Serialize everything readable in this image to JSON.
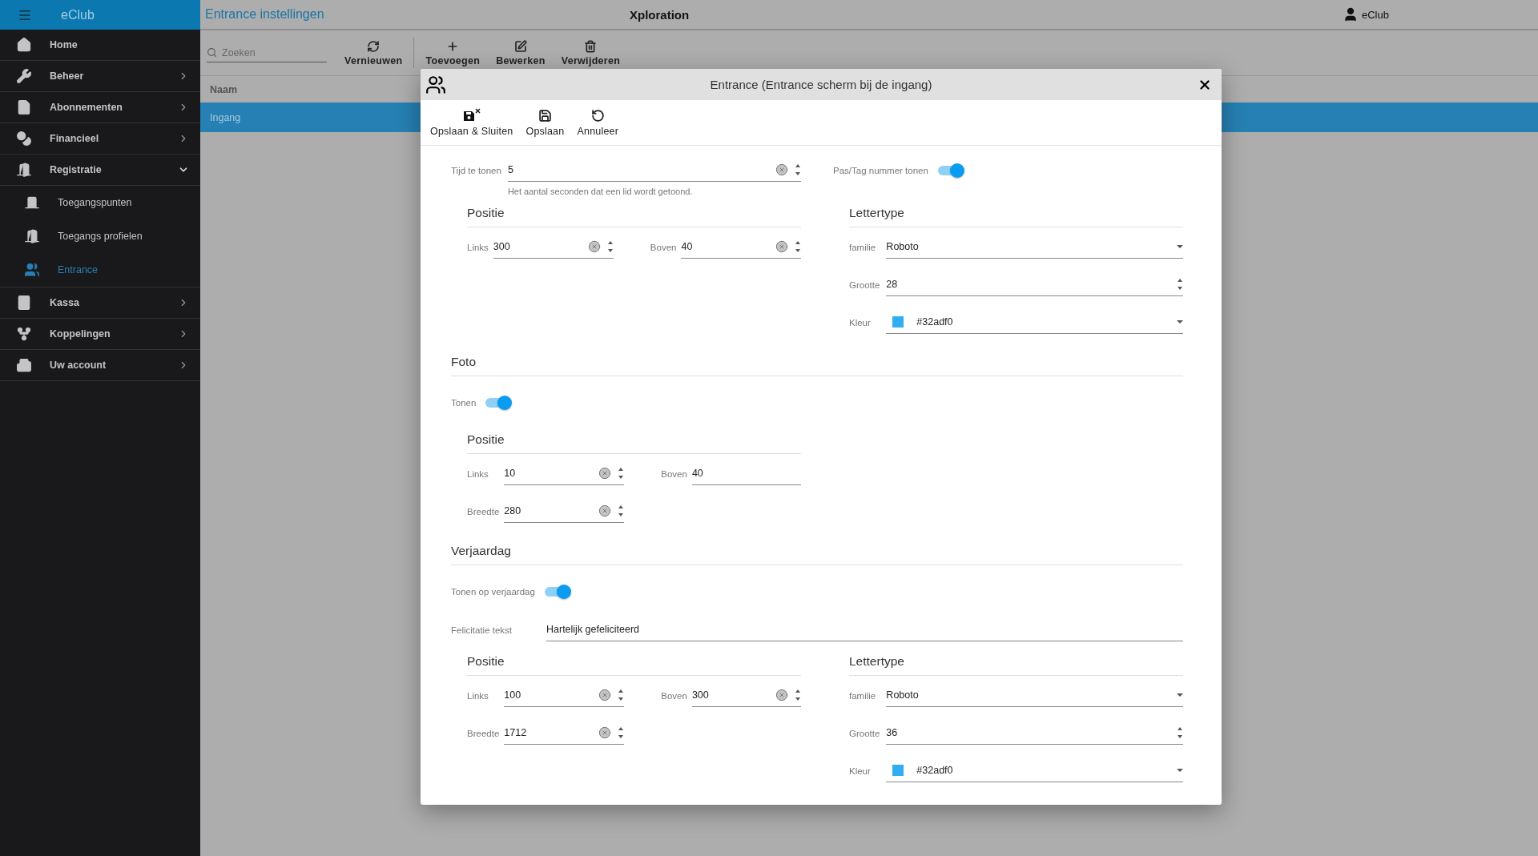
{
  "app": {
    "name": "eClub"
  },
  "sidebar": {
    "items": [
      {
        "label": "Home",
        "selected": false
      },
      {
        "label": "Beheer",
        "expanded": false,
        "selected": false
      },
      {
        "label": "Abonnementen",
        "expanded": false,
        "selected": false
      },
      {
        "label": "Financieel",
        "expanded": false,
        "selected": false
      },
      {
        "label": "Registratie",
        "expanded": true,
        "selected": false,
        "children": [
          {
            "label": "Toegangspunten",
            "selected": false
          },
          {
            "label": "Toegangs profielen",
            "selected": false
          },
          {
            "label": "Entrance",
            "selected": true
          }
        ]
      },
      {
        "label": "Kassa",
        "expanded": false,
        "selected": false
      },
      {
        "label": "Koppelingen",
        "expanded": false,
        "selected": false
      },
      {
        "label": "Uw account",
        "expanded": false,
        "selected": false
      }
    ]
  },
  "header": {
    "title": "Entrance instellingen",
    "center": "Xploration",
    "user": "eClub"
  },
  "toolbar": {
    "search": {
      "placeholder": "Zoeken"
    },
    "buttons": [
      {
        "label": "Vernieuwen"
      },
      {
        "label": "Toevoegen"
      },
      {
        "label": "Bewerken"
      },
      {
        "label": "Verwijderen"
      }
    ]
  },
  "table": {
    "columns": [
      "Naam"
    ],
    "rows": [
      {
        "cells": [
          "Ingang"
        ],
        "selected": true
      }
    ]
  },
  "dialog": {
    "title": "Entrance (Entrance scherm bij de ingang)",
    "toolbar": [
      {
        "label": "Opslaan & Sluiten"
      },
      {
        "label": "Opslaan"
      },
      {
        "label": "Annuleer"
      }
    ],
    "sections": [
      {
        "items": [
          {
            "kind": "pair",
            "field": {
              "kind": "number",
              "label": "Tijd te tonen",
              "value": "5",
              "hint": "Het aantal seconden dat een lid wordt getoond."
            },
            "toggle": {
              "label": "Pas/Tag nummer tonen",
              "on": true
            }
          },
          {
            "kind": "groups",
            "groups": [
              {
                "kind": "position",
                "title": "Positie",
                "fields": [
                  {
                    "kind": "number",
                    "label": "Links",
                    "value": "300"
                  },
                  {
                    "kind": "number",
                    "label": "Boven",
                    "value": "40"
                  }
                ]
              },
              {
                "kind": "font",
                "title": "Lettertype",
                "fields": [
                  {
                    "kind": "select",
                    "label": "familie",
                    "value": "Roboto"
                  },
                  {
                    "kind": "spin",
                    "label": "Grootte",
                    "value": "28"
                  },
                  {
                    "kind": "color",
                    "label": "Kleur",
                    "value": "#32adf0"
                  }
                ]
              }
            ]
          }
        ]
      },
      {
        "heading": "Foto",
        "items": [
          {
            "kind": "toggle",
            "label": "Tonen",
            "on": true
          },
          {
            "kind": "groups",
            "groups": [
              {
                "kind": "position",
                "title": "Positie",
                "fields": [
                  {
                    "kind": "number",
                    "label": "Links",
                    "value": "10"
                  },
                  {
                    "kind": "plain",
                    "label": "Boven",
                    "value": "40"
                  },
                  {
                    "kind": "number",
                    "label": "Breedte",
                    "value": "280"
                  }
                ]
              }
            ]
          }
        ]
      },
      {
        "heading": "Verjaardag",
        "items": [
          {
            "kind": "toggle",
            "label": "Tonen op verjaardag",
            "on": true
          },
          {
            "kind": "text",
            "label": "Felicitatie tekst",
            "value": "Hartelijk gefeliciteerd"
          },
          {
            "kind": "groups",
            "groups": [
              {
                "kind": "position",
                "title": "Positie",
                "fields": [
                  {
                    "kind": "number",
                    "label": "Links",
                    "value": "100"
                  },
                  {
                    "kind": "number",
                    "label": "Boven",
                    "value": "300"
                  },
                  {
                    "kind": "number",
                    "label": "Breedte",
                    "value": "1712"
                  }
                ]
              },
              {
                "kind": "font",
                "title": "Lettertype",
                "fields": [
                  {
                    "kind": "select",
                    "label": "familie",
                    "value": "Roboto"
                  },
                  {
                    "kind": "spin",
                    "label": "Grootte",
                    "value": "36"
                  },
                  {
                    "kind": "color",
                    "label": "Kleur",
                    "value": "#32adf0"
                  }
                ]
              }
            ]
          }
        ]
      }
    ]
  }
}
